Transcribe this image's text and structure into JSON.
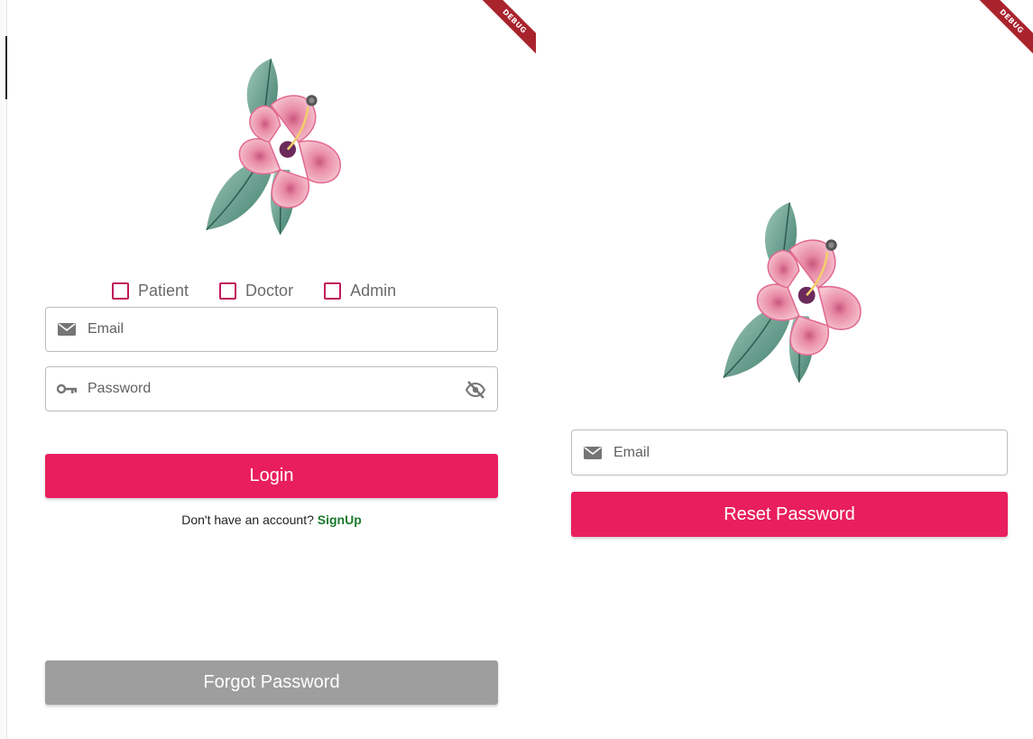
{
  "colors": {
    "primary": "#e91e5e",
    "checkbox_border": "#c2185b",
    "link": "#1b7a2e",
    "disabled_button": "#9e9e9e",
    "debug_banner": "#a9232d"
  },
  "debug_banner": "DEBUG",
  "login_screen": {
    "logo_icon": "hibiscus-flower-icon",
    "roles": [
      {
        "label": "Patient",
        "checked": false
      },
      {
        "label": "Doctor",
        "checked": false
      },
      {
        "label": "Admin",
        "checked": false
      }
    ],
    "email": {
      "icon": "mail-icon",
      "placeholder": "Email",
      "value": ""
    },
    "password": {
      "icon": "key-icon",
      "placeholder": "Password",
      "value": "",
      "toggle_icon": "visibility-off-icon"
    },
    "login_button": "Login",
    "signup_prompt": "Don't have an account?",
    "signup_link": "SignUp",
    "forgot_button": "Forgot Password"
  },
  "reset_screen": {
    "logo_icon": "hibiscus-flower-icon",
    "email": {
      "icon": "mail-icon",
      "placeholder": "Email",
      "value": ""
    },
    "reset_button": "Reset Password"
  }
}
